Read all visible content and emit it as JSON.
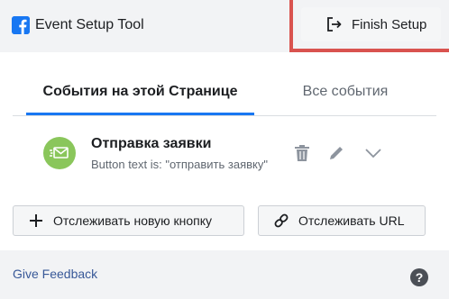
{
  "app": {
    "title": "Event Setup Tool",
    "finish_label": "Finish Setup"
  },
  "tabs": [
    {
      "label": "События на этой Странице",
      "active": true
    },
    {
      "label": "Все события",
      "active": false
    }
  ],
  "event": {
    "name": "Отправка заявки",
    "description": "Button text is: \"отправить заявку\"",
    "icon": "envelope-send-icon",
    "icon_color": "#8ac65b"
  },
  "actions": {
    "track_button_label": "Отслеживать новую кнопку",
    "track_url_label": "Отслеживать URL"
  },
  "footer": {
    "feedback_label": "Give Feedback",
    "help_glyph": "?"
  },
  "colors": {
    "accent": "#1877f2",
    "highlight_border": "#d9534f",
    "link": "#385898"
  }
}
